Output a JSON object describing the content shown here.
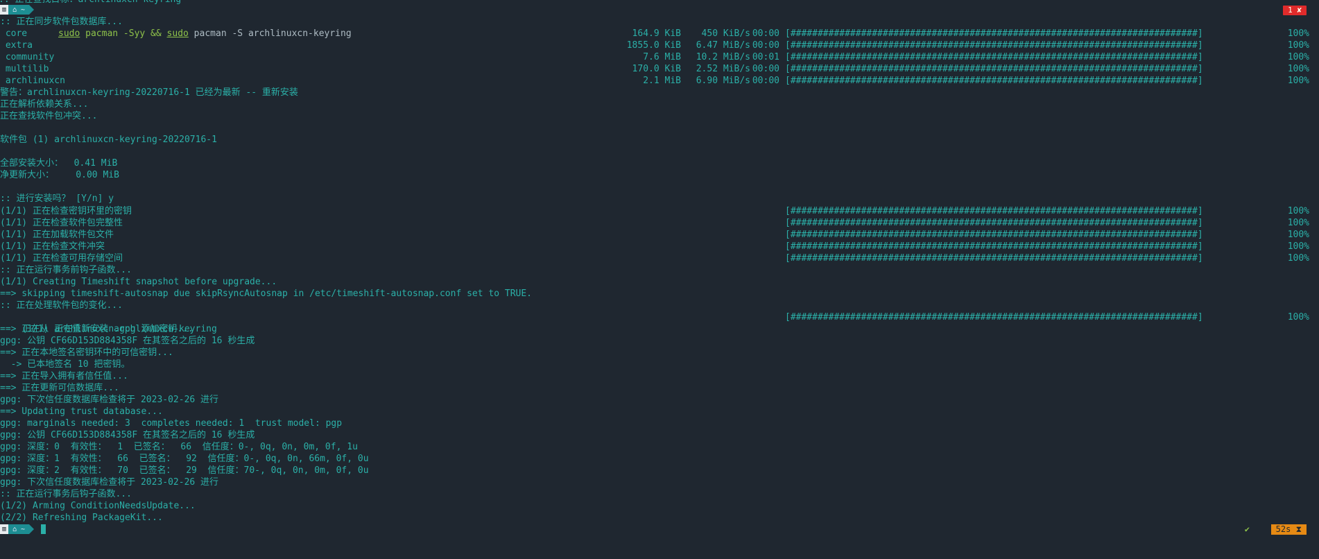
{
  "top_partial": ":: 正在查找目标：archlinuxcn-keyring",
  "prompt1": {
    "os_glyph": "▥",
    "home_glyph": "⌂ ~",
    "cmd_sudo1": "sudo",
    "cmd_part1": " pacman -Syy && ",
    "cmd_sudo2": "sudo",
    "cmd_part2": " pacman -S archlinuxcn-keyring"
  },
  "error_badge": "1 ✘",
  "sync_header": ":: 正在同步软件包数据库...",
  "sync_rows": [
    {
      "name": " core",
      "size": "164.9 KiB",
      "speed": "450 KiB/s",
      "time": "00:00"
    },
    {
      "name": " extra",
      "size": "1855.0 KiB",
      "speed": "6.47 MiB/s",
      "time": "00:00"
    },
    {
      "name": " community",
      "size": "7.6 MiB",
      "speed": "10.2 MiB/s",
      "time": "00:01"
    },
    {
      "name": " multilib",
      "size": "170.0 KiB",
      "speed": "2.52 MiB/s",
      "time": "00:00"
    },
    {
      "name": " archlinuxcn",
      "size": "2.1 MiB",
      "speed": "6.90 MiB/s",
      "time": "00:00"
    }
  ],
  "bar_text": "[###########################################################################]",
  "pct_text": "100%",
  "lines_a": [
    "警告：archlinuxcn-keyring-20220716-1 已经为最新 -- 重新安装",
    "正在解析依赖关系...",
    "正在查找软件包冲突...",
    "",
    "软件包 (1) archlinuxcn-keyring-20220716-1",
    "",
    "全部安装大小：  0.41 MiB",
    "净更新大小：    0.00 MiB",
    "",
    ":: 进行安装吗？ [Y/n] y"
  ],
  "check_rows": [
    "(1/1) 正在检查密钥环里的密钥",
    "(1/1) 正在检查软件包完整性",
    "(1/1) 正在加载软件包文件",
    "(1/1) 正在检查文件冲突",
    "(1/1) 正在检查可用存储空间"
  ],
  "lines_b": [
    ":: 正在运行事务前钩子函数...",
    "(1/1) Creating Timeshift snapshot before upgrade...",
    "==> skipping timeshift-autosnap due skipRsyncAutosnap in /etc/timeshift-autosnap.conf set to TRUE.",
    ":: 正在处理软件包的变化..."
  ],
  "reinstall_row": "(1/1) 正在重新安装 archlinuxcn-keyring",
  "lines_c": [
    "==> 正在从 archlinuxcn.gpg 添加密钥...",
    "gpg: 公钥 CF66D153D884358F 在其签名之后的 16 秒生成",
    "==> 正在本地签名密钥环中的可信密钥...",
    "  -> 已本地签名 10 把密钥。",
    "==> 正在导入拥有者信任值...",
    "==> 正在更新可信数据库...",
    "gpg: 下次信任度数据库检查将于 2023-02-26 进行",
    "==> Updating trust database...",
    "gpg: marginals needed: 3  completes needed: 1  trust model: pgp",
    "gpg: 公钥 CF66D153D884358F 在其签名之后的 16 秒生成",
    "gpg: 深度：0  有效性：  1  已签名：  66  信任度：0-, 0q, 0n, 0m, 0f, 1u",
    "gpg: 深度：1  有效性：  66  已签名：  92  信任度：0-, 0q, 0n, 66m, 0f, 0u",
    "gpg: 深度：2  有效性：  70  已签名：  29  信任度：70-, 0q, 0n, 0m, 0f, 0u",
    "gpg: 下次信任度数据库检查将于 2023-02-26 进行",
    ":: 正在运行事务后钩子函数...",
    "(1/2) Arming ConditionNeedsUpdate...",
    "(2/2) Refreshing PackageKit..."
  ],
  "prompt2": {
    "os_glyph": "▥",
    "home_glyph": "⌂ ~"
  },
  "check_mark": "✔",
  "time_badge": "52s ⧗"
}
